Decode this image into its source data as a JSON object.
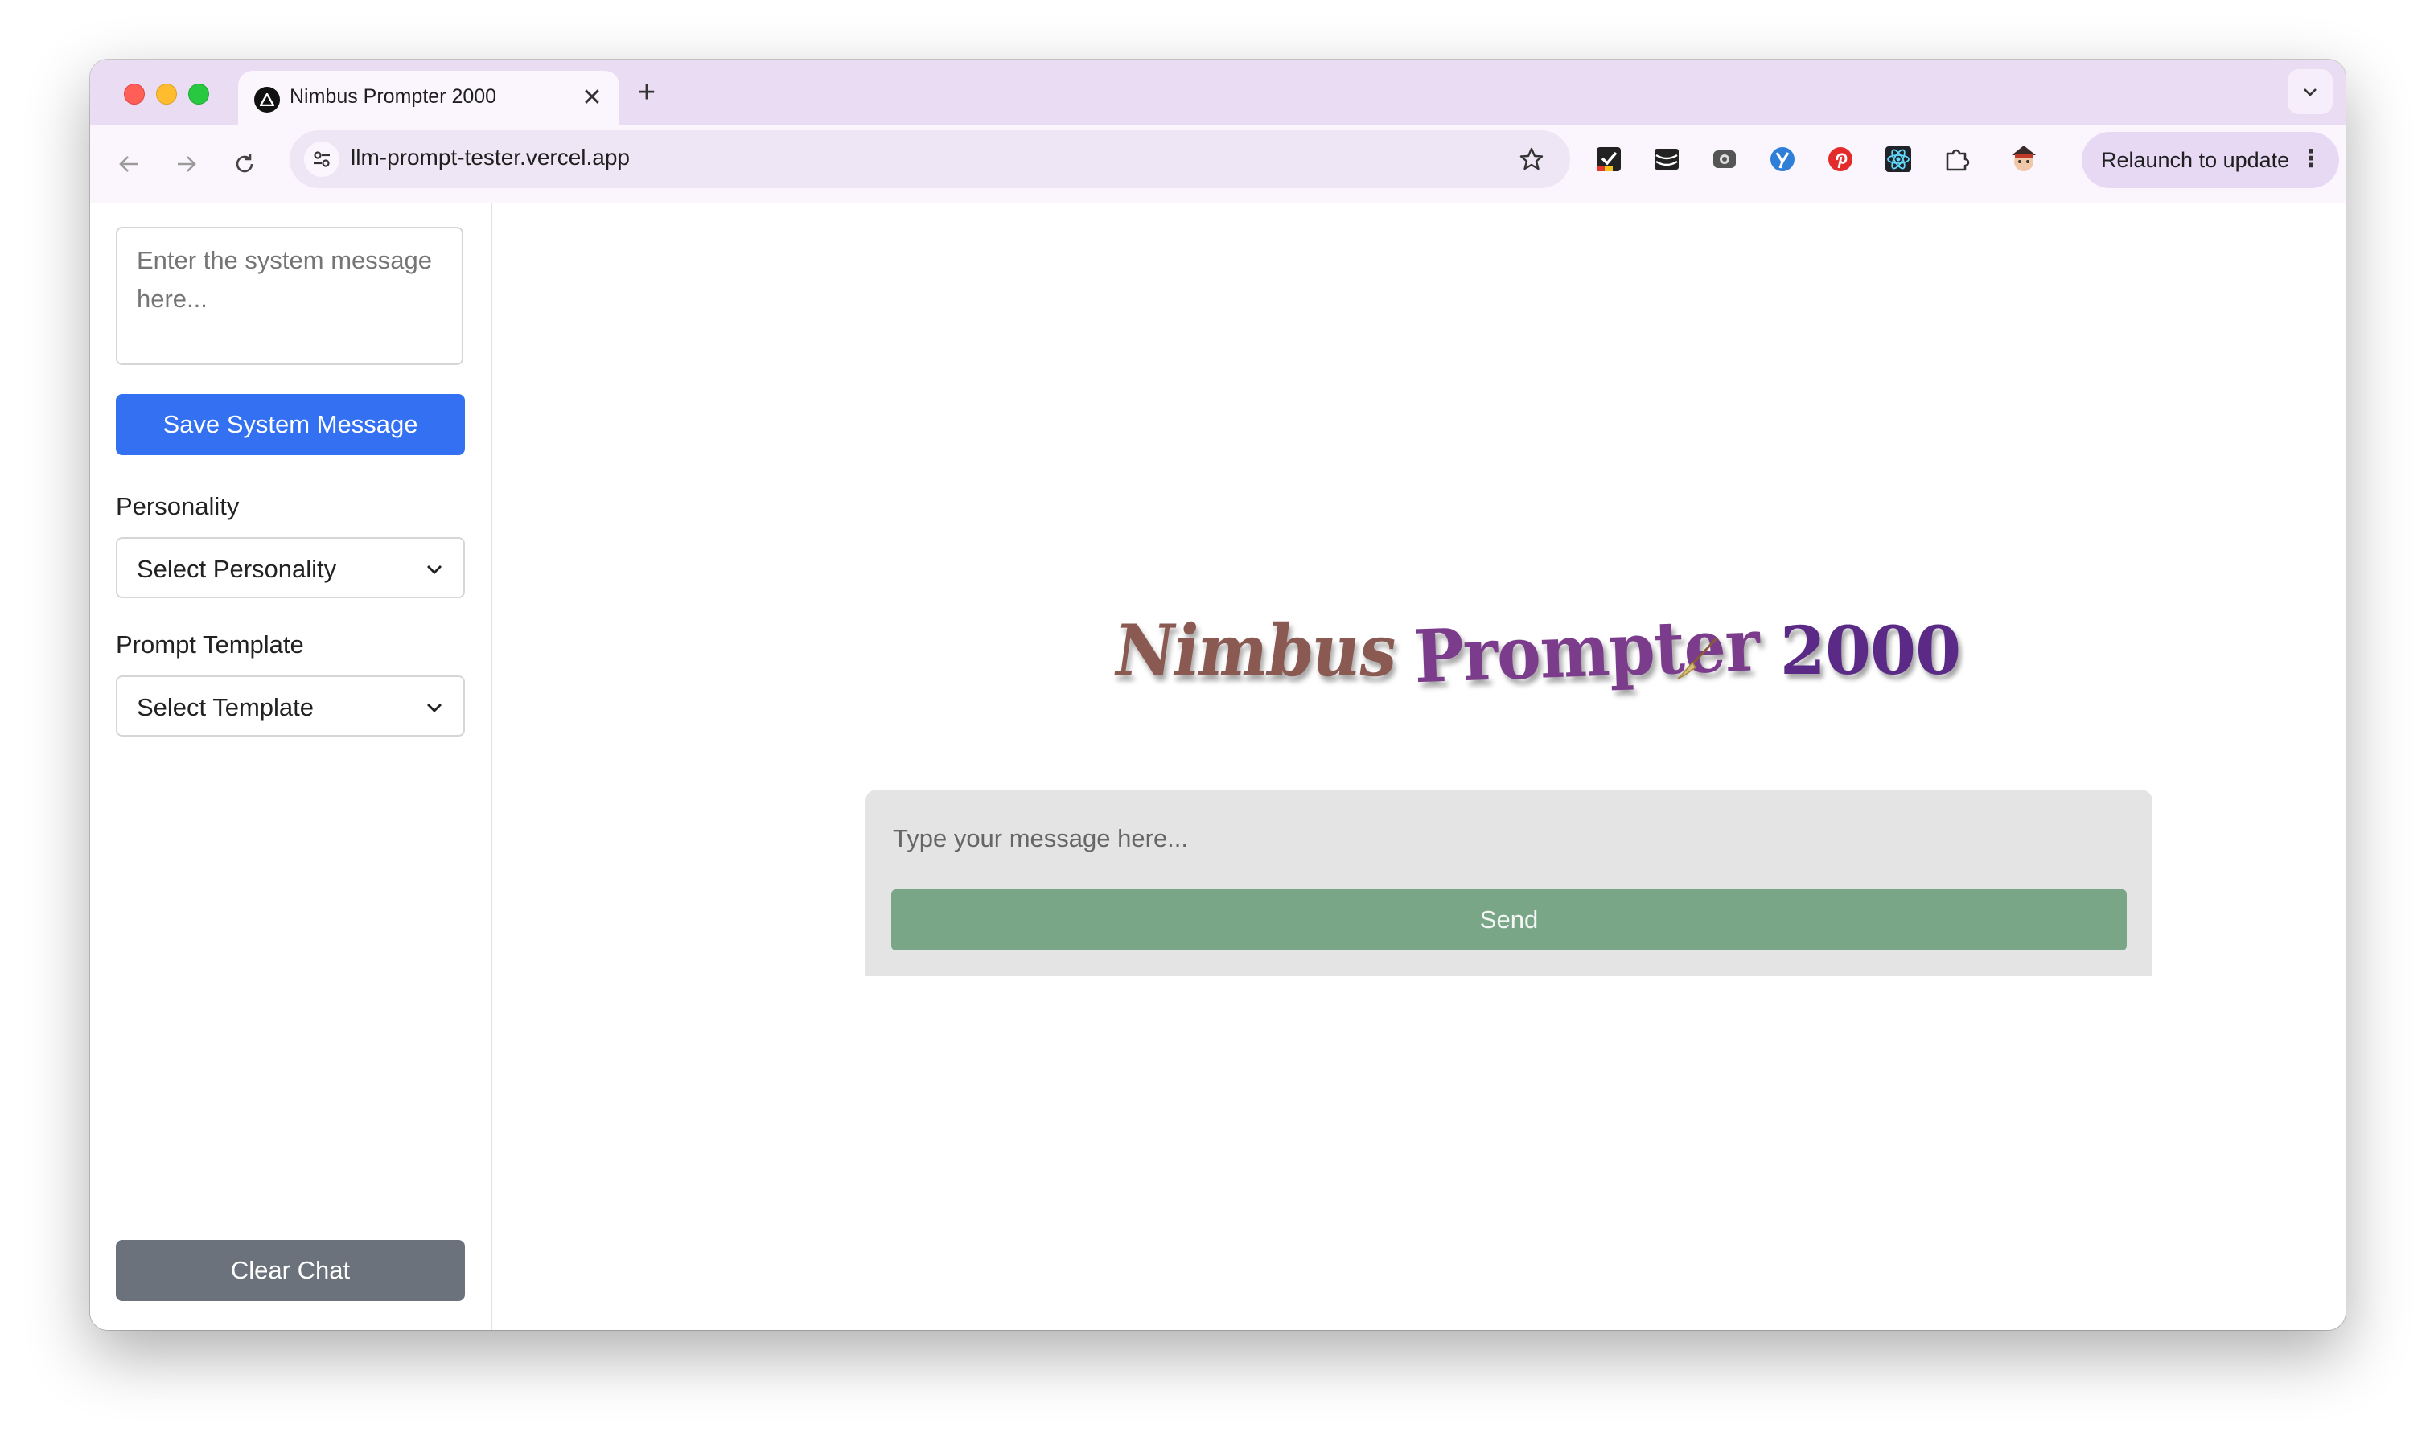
{
  "browser": {
    "tab_title": "Nimbus Prompter 2000",
    "tab_close": "✕",
    "new_tab": "+",
    "url": "llm-prompt-tester.vercel.app",
    "relaunch_label": "Relaunch to update",
    "relaunch_menu": "⋮",
    "extensions": [
      "checkmark-extension-icon",
      "stripes-extension-icon",
      "camera-extension-icon",
      "y-extension-icon",
      "pinterest-extension-icon",
      "react-devtools-icon",
      "puzzle-extensions-icon",
      "profile-avatar-icon"
    ]
  },
  "sidebar": {
    "system_message_placeholder": "Enter the system message here...",
    "save_label": "Save System Message",
    "personality_label": "Personality",
    "personality_value": "Select Personality",
    "template_label": "Prompt Template",
    "template_value": "Select Template",
    "clear_label": "Clear Chat"
  },
  "main": {
    "brand_words": [
      "Nimbus",
      "Prompter",
      "2000"
    ],
    "message_placeholder": "Type your message here...",
    "send_label": "Send"
  },
  "colors": {
    "tabstrip": "#eadcf3",
    "save_button": "#3371f2",
    "clear_button": "#6b727b",
    "send_button": "#7aa688",
    "chat_panel": "#e4e4e4"
  }
}
